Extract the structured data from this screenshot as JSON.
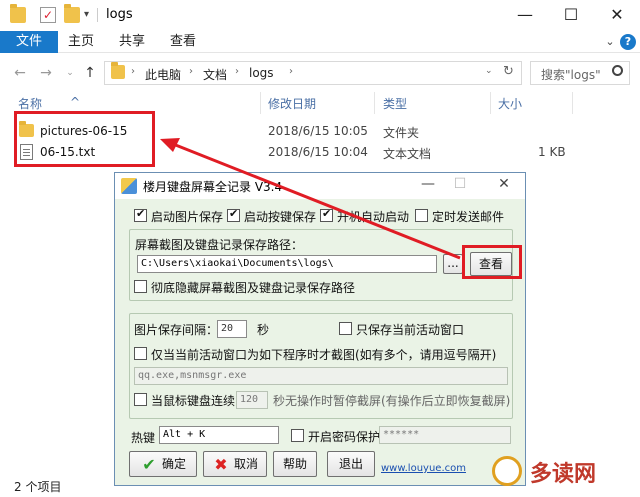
{
  "explorer": {
    "title": "logs",
    "ribbon_tabs": [
      "文件",
      "主页",
      "共享",
      "查看"
    ],
    "breadcrumb": [
      "此电脑",
      "文档",
      "logs"
    ],
    "search_placeholder": "搜索\"logs\"",
    "columns": {
      "name": "名称",
      "modified": "修改日期",
      "type": "类型",
      "size": "大小"
    },
    "files": [
      {
        "name": "pictures-06-15",
        "modified": "2018/6/15 10:05",
        "type": "文件夹",
        "size": "",
        "icon": "folder-icon"
      },
      {
        "name": "06-15.txt",
        "modified": "2018/6/15 10:04",
        "type": "文本文档",
        "size": "1 KB",
        "icon": "text-file-icon"
      }
    ],
    "status": "2 个项目"
  },
  "dialog": {
    "title": "楼月键盘屏幕全记录 V3.4",
    "opt_auto_pic": "启动图片保存",
    "opt_auto_key": "启动按键保存",
    "opt_autostart": "开机自动启动",
    "opt_email": "定时发送邮件",
    "path_label": "屏幕截图及键盘记录保存路径：",
    "path_value": "C:\\Users\\xiaokai\\Documents\\logs\\",
    "browse_label": "...",
    "view_label": "查看",
    "hide_path_label": "彻底隐藏屏幕截图及键盘记录保存路径",
    "interval_label": "图片保存间隔：",
    "interval_value": "20",
    "interval_unit": "秒",
    "active_only_label": "只保存当前活动窗口",
    "capture_when_label": "仅当当前活动窗口为如下程序时才截图(如有多个，请用逗号隔开)",
    "programs_value": "qq.exe,msnmsgr.exe",
    "idle_label": "当鼠标键盘连续",
    "idle_value": "120",
    "idle_suffix": "秒无操作时暂停截屏(有操作后立即恢复截屏)",
    "hotkey_label": "热键",
    "hotkey_value": "Alt + K",
    "password_label": "开启密码保护",
    "password_value": "******",
    "ok_label": "确定",
    "cancel_label": "取消",
    "help_label": "帮助",
    "exit_label": "退出",
    "website": "www.louyue.com"
  },
  "watermark": "多读网",
  "colors": {
    "annotation_red": "#e01c24",
    "ribbon_blue": "#1979ca"
  }
}
